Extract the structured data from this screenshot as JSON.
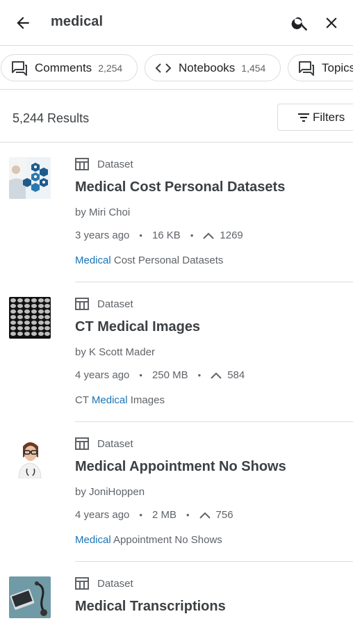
{
  "search": {
    "query": "medical"
  },
  "chips": [
    {
      "label": "Comments",
      "count": "2,254",
      "icon": "comment-icon"
    },
    {
      "label": "Notebooks",
      "count": "1,454",
      "icon": "code-icon"
    },
    {
      "label": "Topics",
      "count": "",
      "icon": "comment-icon"
    }
  ],
  "results": {
    "count_label": "5,244 Results",
    "filters_label": "Filters"
  },
  "items": [
    {
      "type": "Dataset",
      "title": "Medical Cost Personal Datasets",
      "author": "by Miri Choi",
      "age": "3 years ago",
      "size": "16 KB",
      "votes": "1269",
      "snippet_pre": "",
      "snippet_hl": "Medical",
      "snippet_post": " Cost Personal Datasets"
    },
    {
      "type": "Dataset",
      "title": "CT Medical Images",
      "author": "by K Scott Mader",
      "age": "4 years ago",
      "size": "250 MB",
      "votes": "584",
      "snippet_pre": "CT ",
      "snippet_hl": "Medical",
      "snippet_post": " Images"
    },
    {
      "type": "Dataset",
      "title": "Medical Appointment No Shows",
      "author": "by JoniHoppen",
      "age": "4 years ago",
      "size": "2 MB",
      "votes": "756",
      "snippet_pre": "",
      "snippet_hl": "Medical",
      "snippet_post": " Appointment No Shows"
    },
    {
      "type": "Dataset",
      "title": "Medical Transcriptions",
      "author": "",
      "age": "",
      "size": "",
      "votes": "",
      "snippet_pre": "",
      "snippet_hl": "",
      "snippet_post": ""
    }
  ],
  "colors": {
    "highlight": "#1a73b8",
    "text": "#3c4043",
    "muted": "#5f6368",
    "border": "#dadce0"
  }
}
